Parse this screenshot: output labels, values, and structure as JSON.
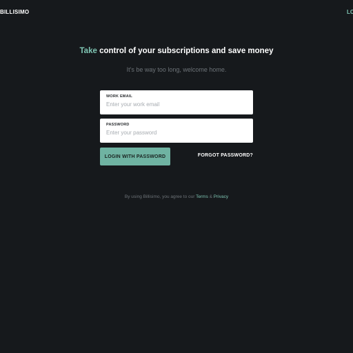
{
  "header": {
    "brand": "BILLISIMO",
    "login_link": "LOGIN"
  },
  "hero": {
    "title_accent": "Take",
    "title_rest": " control of your subscriptions and save money",
    "subtitle": "It's be way too long, welcome home."
  },
  "form": {
    "email": {
      "label": "WORK EMAIL",
      "placeholder": "Enter your work email",
      "value": ""
    },
    "password": {
      "label": "PASSWORD",
      "placeholder": "Enter your password",
      "value": ""
    },
    "login_button": "LOGIN WITH PASSWORD",
    "forgot_link": "FORGOT PASSWORD?"
  },
  "footer": {
    "legal_prefix": "By using Billisimo, you agree to our ",
    "terms": "Terms",
    "amp": " & ",
    "privacy": "Privacy"
  },
  "colors": {
    "background": "#16191c",
    "accent": "#7fc5b3",
    "button": "#6fb3a2"
  }
}
